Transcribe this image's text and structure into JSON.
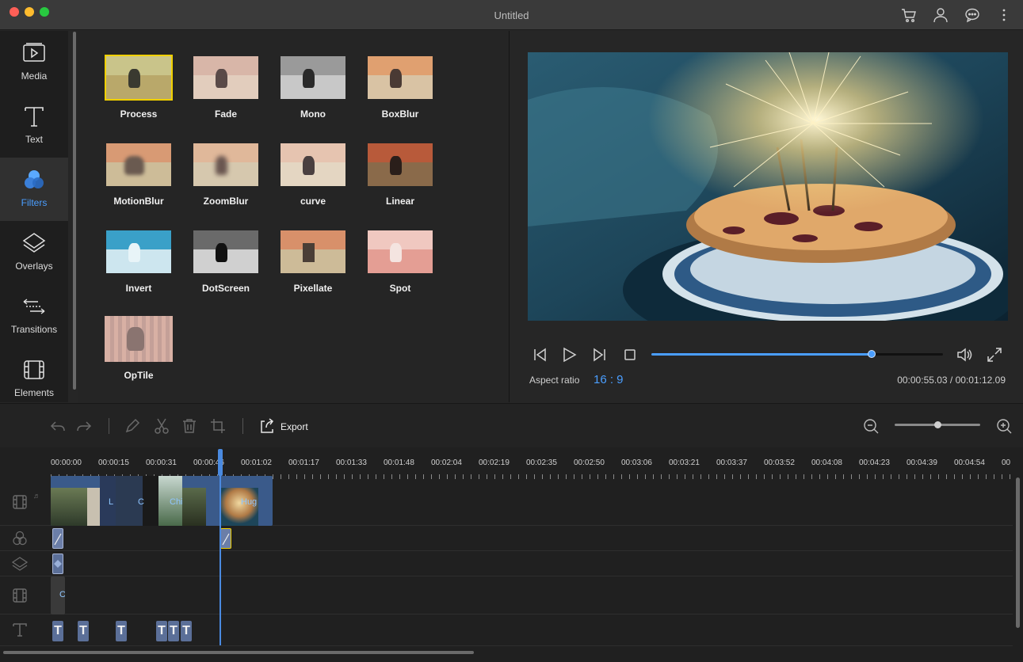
{
  "window": {
    "title": "Untitled"
  },
  "titlebar_icons": [
    "cart-icon",
    "user-icon",
    "chat-icon",
    "more-icon"
  ],
  "sidebar": {
    "items": [
      {
        "label": "Media",
        "icon": "media-icon",
        "active": false
      },
      {
        "label": "Text",
        "icon": "text-icon",
        "active": false
      },
      {
        "label": "Filters",
        "icon": "filters-icon",
        "active": true
      },
      {
        "label": "Overlays",
        "icon": "overlays-icon",
        "active": false
      },
      {
        "label": "Transitions",
        "icon": "transitions-icon",
        "active": false
      },
      {
        "label": "Elements",
        "icon": "elements-icon",
        "active": false
      }
    ]
  },
  "filters": {
    "items": [
      {
        "label": "Process",
        "selected": true
      },
      {
        "label": "Fade",
        "selected": false
      },
      {
        "label": "Mono",
        "selected": false
      },
      {
        "label": "BoxBlur",
        "selected": false
      },
      {
        "label": "MotionBlur",
        "selected": false
      },
      {
        "label": "ZoomBlur",
        "selected": false
      },
      {
        "label": "curve",
        "selected": false
      },
      {
        "label": "Linear",
        "selected": false
      },
      {
        "label": "Invert",
        "selected": false
      },
      {
        "label": "DotScreen",
        "selected": false
      },
      {
        "label": "Pixellate",
        "selected": false
      },
      {
        "label": "Spot",
        "selected": false
      },
      {
        "label": "OpTile",
        "selected": false
      }
    ]
  },
  "player": {
    "aspect_label": "Aspect ratio",
    "aspect_value": "16 : 9",
    "timecode": "00:00:55.03 / 00:01:12.09",
    "progress": 0.755
  },
  "toolbar": {
    "export_label": "Export",
    "zoom_level": 0.5
  },
  "timeline": {
    "ruler_labels": [
      "00:00:00",
      "00:00:15",
      "00:00:31",
      "00:00:46",
      "00:01:02",
      "00:01:17",
      "00:01:33",
      "00:01:48",
      "00:02:04",
      "00:02:19",
      "00:02:35",
      "00:02:50",
      "00:03:06",
      "00:03:21",
      "00:03:37",
      "00:03:52",
      "00:04:08",
      "00:04:23",
      "00:04:39",
      "00:04:54",
      "00"
    ],
    "clip_labels": {
      "l": "L",
      "c": "C",
      "chi": "Chi",
      "hug": "Hug",
      "overlay_c": "C"
    },
    "text_chip_glyph": "T"
  },
  "colors": {
    "accent": "#4a9eff",
    "selection": "#f0d000",
    "clip": "#3a5a8a"
  }
}
